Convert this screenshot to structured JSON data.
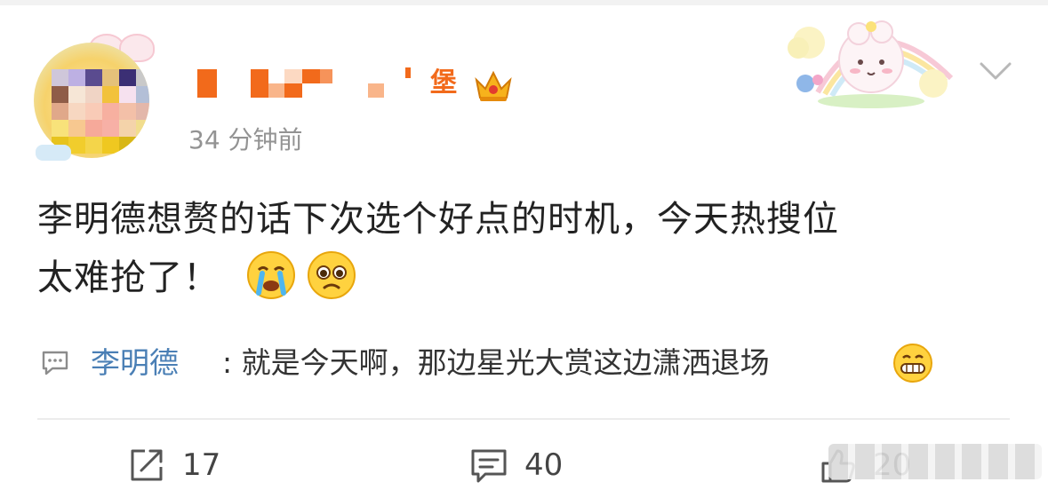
{
  "post": {
    "username_visible_fragment": "堡",
    "timestamp": "34 分钟前",
    "text_line1": "李明德想赘的话下次选个好点的时机，今天热搜位",
    "text_line2": "太难抢了！",
    "emojis": [
      "crying-emoji",
      "pleading-emoji"
    ]
  },
  "comment_preview": {
    "author": "李明德",
    "text": ": 就是今天啊，那边星光大赏这边潇洒退场"
  },
  "actions": {
    "share_count": "17",
    "comment_count": "40",
    "like_count": "20"
  },
  "colors": {
    "username_orange": "#f26a1b",
    "timestamp_gray": "#939393",
    "author_blue": "#4a7fb5",
    "divider": "#ececec"
  },
  "icons": [
    "avatar",
    "crown-badge-icon",
    "chevron-down-icon",
    "comment-bubble-icon",
    "share-icon",
    "like-icon",
    "grin-emoji"
  ]
}
